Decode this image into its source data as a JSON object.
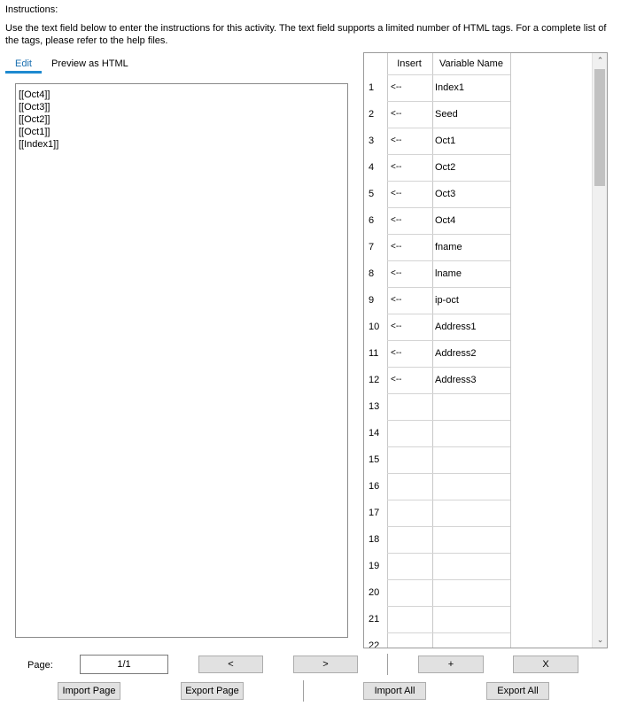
{
  "instructions": {
    "title": "Instructions:",
    "description": "Use the text field below to enter the instructions for this activity. The text field supports a limited number of HTML tags. For a complete list of the tags, please refer to the help files."
  },
  "tabs": [
    {
      "label": "Edit",
      "active": true
    },
    {
      "label": "Preview as HTML",
      "active": false
    }
  ],
  "editor": {
    "lines": [
      "[[Oct4]]",
      "[[Oct3]]",
      "[[Oct2]]",
      "[[Oct1]]",
      "[[Index1]]"
    ]
  },
  "variables": {
    "headers": {
      "insert": "Insert",
      "name": "Variable Name"
    },
    "rows": [
      {
        "num": "1",
        "insert": "<--",
        "name": "Index1"
      },
      {
        "num": "2",
        "insert": "<--",
        "name": "Seed"
      },
      {
        "num": "3",
        "insert": "<--",
        "name": "Oct1"
      },
      {
        "num": "4",
        "insert": "<--",
        "name": "Oct2"
      },
      {
        "num": "5",
        "insert": "<--",
        "name": "Oct3"
      },
      {
        "num": "6",
        "insert": "<--",
        "name": "Oct4"
      },
      {
        "num": "7",
        "insert": "<--",
        "name": "fname"
      },
      {
        "num": "8",
        "insert": "<--",
        "name": "lname"
      },
      {
        "num": "9",
        "insert": "<--",
        "name": "ip-oct"
      },
      {
        "num": "10",
        "insert": "<--",
        "name": "Address1"
      },
      {
        "num": "11",
        "insert": "<--",
        "name": "Address2"
      },
      {
        "num": "12",
        "insert": "<--",
        "name": "Address3"
      },
      {
        "num": "13",
        "insert": "",
        "name": ""
      },
      {
        "num": "14",
        "insert": "",
        "name": ""
      },
      {
        "num": "15",
        "insert": "",
        "name": ""
      },
      {
        "num": "16",
        "insert": "",
        "name": ""
      },
      {
        "num": "17",
        "insert": "",
        "name": ""
      },
      {
        "num": "18",
        "insert": "",
        "name": ""
      },
      {
        "num": "19",
        "insert": "",
        "name": ""
      },
      {
        "num": "20",
        "insert": "",
        "name": ""
      },
      {
        "num": "21",
        "insert": "",
        "name": ""
      },
      {
        "num": "22",
        "insert": "",
        "name": ""
      }
    ],
    "scroll_up_icon": "chevron-up-icon",
    "scroll_down_icon": "chevron-down-icon"
  },
  "pager": {
    "label": "Page:",
    "value": "1/1",
    "prev_label": "<",
    "next_label": ">",
    "add_label": "+",
    "delete_label": "X"
  },
  "actions": {
    "import_page": "Import Page",
    "export_page": "Export Page",
    "import_all": "Import All",
    "export_all": "Export All"
  }
}
